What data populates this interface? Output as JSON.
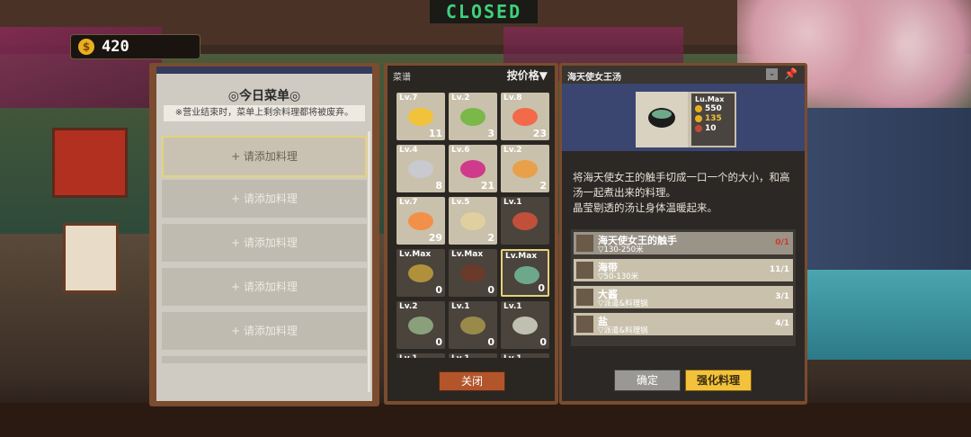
{
  "hud": {
    "closed_sign": "CLOSED",
    "coins": "420",
    "coin_symbol": "$"
  },
  "menu_panel": {
    "title": "◎今日菜单◎",
    "note": "※营业结束时，菜单上剩余料理都将被废弃。",
    "slots": [
      "+ 请添加料理",
      "+ 请添加料理",
      "+ 请添加料理",
      "+ 请添加料理",
      "+ 请添加料理"
    ]
  },
  "recipe_panel": {
    "header": "菜谱",
    "sort_label": "按价格",
    "close_label": "关闭",
    "items": [
      {
        "level": "Lv.7",
        "count": "11",
        "color": "#f2c23a"
      },
      {
        "level": "Lv.2",
        "count": "3",
        "color": "#7ab84a"
      },
      {
        "level": "Lv.8",
        "count": "23",
        "color": "#f26a4a"
      },
      {
        "level": "Lv.4",
        "count": "8",
        "color": "#c9c9d0"
      },
      {
        "level": "Lv.6",
        "count": "21",
        "color": "#d03a8a"
      },
      {
        "level": "Lv.2",
        "count": "2",
        "color": "#e8a04a"
      },
      {
        "level": "Lv.7",
        "count": "29",
        "color": "#f2904a"
      },
      {
        "level": "Lv.5",
        "count": "2",
        "color": "#e0d0a0"
      },
      {
        "level": "Lv.1",
        "count": "",
        "color": "#c0503a"
      },
      {
        "level": "Lv.Max",
        "count": "0",
        "color": "#b0903a"
      },
      {
        "level": "Lv.Max",
        "count": "0",
        "color": "#6a3a2a"
      },
      {
        "level": "Lv.Max",
        "count": "0",
        "color": "#6ea88a"
      },
      {
        "level": "Lv.2",
        "count": "0",
        "color": "#8aa07a"
      },
      {
        "level": "Lv.1",
        "count": "0",
        "color": "#9a8a4a"
      },
      {
        "level": "Lv.1",
        "count": "0",
        "color": "#c0c0b0"
      },
      {
        "level": "Lv.1",
        "count": "",
        "color": "#555"
      },
      {
        "level": "Lv.1",
        "count": "",
        "color": "#555"
      },
      {
        "level": "Lv.1",
        "count": "",
        "color": "#555"
      }
    ]
  },
  "detail_panel": {
    "title": "海天使女王汤",
    "level": "Lu.Max",
    "price": "550",
    "appeal": "135",
    "portions": "10",
    "description_lines": [
      "将海天使女王的触手切成一口一个的大小，和高",
      "汤一起煮出来的料理。",
      "晶莹剔透的汤让身体温暖起来。"
    ],
    "ingredients": [
      {
        "name": "海天使女王的触手",
        "source": "▽130-250米",
        "qty": "0/1",
        "missing": true
      },
      {
        "name": "海带",
        "source": "▽50-130米",
        "qty": "11/1",
        "missing": false
      },
      {
        "name": "大酱",
        "source": "▽派遣&料理锅",
        "qty": "3/1",
        "missing": false
      },
      {
        "name": "盐",
        "source": "▽派遣&料理锅",
        "qty": "4/1",
        "missing": false
      }
    ],
    "confirm_label": "确定",
    "enhance_label": "强化料理"
  },
  "colors": {
    "accent": "#f2c23a",
    "panel_frame": "#7b4c2e",
    "banner": "#3a4670",
    "missing": "#d23a2a"
  }
}
